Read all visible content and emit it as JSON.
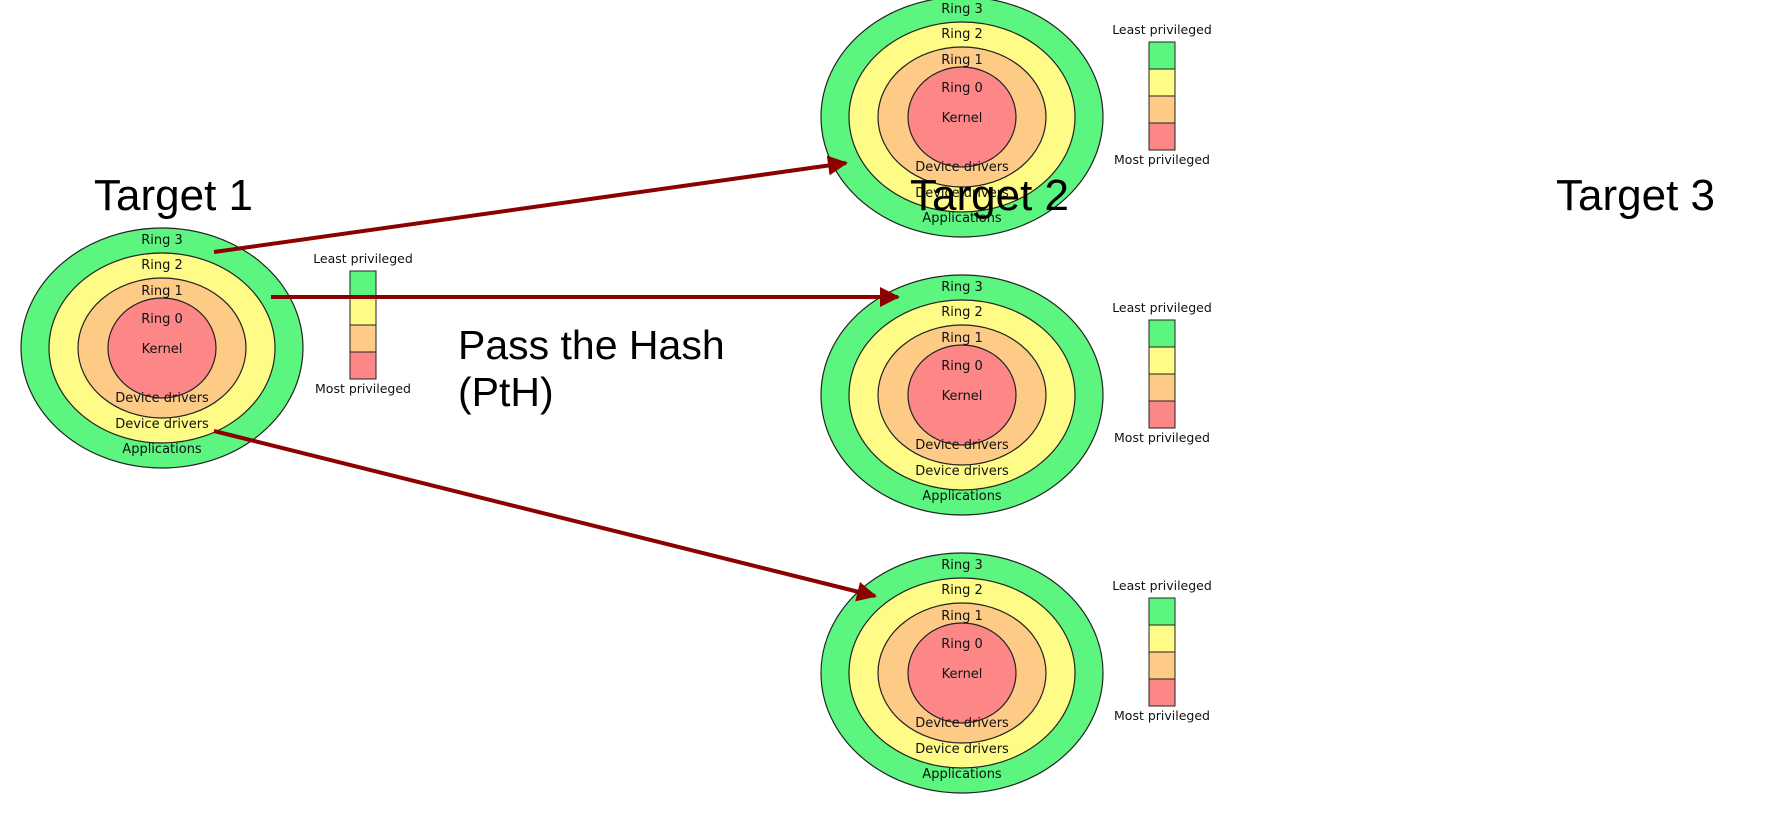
{
  "titles": {
    "target1": "Target 1",
    "target2": "Target 2",
    "target3": "Target 3"
  },
  "caption": {
    "line1": "Pass the Hash",
    "line2": "(PtH)"
  },
  "ring_diagram": {
    "rings": {
      "ring3": "Ring 3",
      "ring2": "Ring 2",
      "ring1": "Ring 1",
      "ring0": "Ring 0",
      "kernel": "Kernel",
      "device_drivers_inner": "Device drivers",
      "device_drivers_outer": "Device drivers",
      "applications": "Applications"
    },
    "legend": {
      "least": "Least privileged",
      "most": "Most privileged"
    },
    "colors": {
      "ring3": "#5cf57f",
      "ring2": "#fefb86",
      "ring1": "#fdcb86",
      "ring0": "#fd8787",
      "outline": "#222222"
    }
  },
  "arrows": {
    "color": "#8b0000"
  }
}
